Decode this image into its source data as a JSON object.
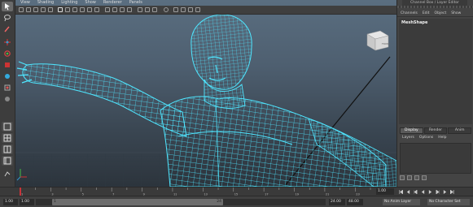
{
  "viewport": {
    "menu": [
      "View",
      "Shading",
      "Lighting",
      "Show",
      "Renderer",
      "Panels"
    ],
    "viewcube_label": "FRONT"
  },
  "right_panel": {
    "title": "Channel Box / Layer Editor",
    "menu": [
      "Channels",
      "Edit",
      "Object",
      "Show"
    ],
    "node_name": "MeshShape",
    "layer_tabs": [
      "Display",
      "Render",
      "Anim"
    ],
    "layer_menu": [
      "Layers",
      "Options",
      "Help"
    ]
  },
  "timeline": {
    "ticks": [
      "1",
      "2",
      "3",
      "4",
      "5",
      "6",
      "7",
      "8",
      "9",
      "10",
      "11",
      "12",
      "13",
      "14",
      "15",
      "16",
      "17",
      "18",
      "19",
      "20",
      "21",
      "22",
      "23",
      "24"
    ],
    "current_frame": "1.00"
  },
  "range": {
    "start_time": "1.00",
    "playback_start": "1.00",
    "handle_start": "1",
    "handle_end": "24",
    "playback_end": "24.00",
    "end_time": "48.00",
    "anim_layer": "No Anim Layer",
    "char_set": "No Character Set"
  },
  "colors": {
    "wireframe": "#4fe6ff",
    "accent": "#c8343b"
  }
}
